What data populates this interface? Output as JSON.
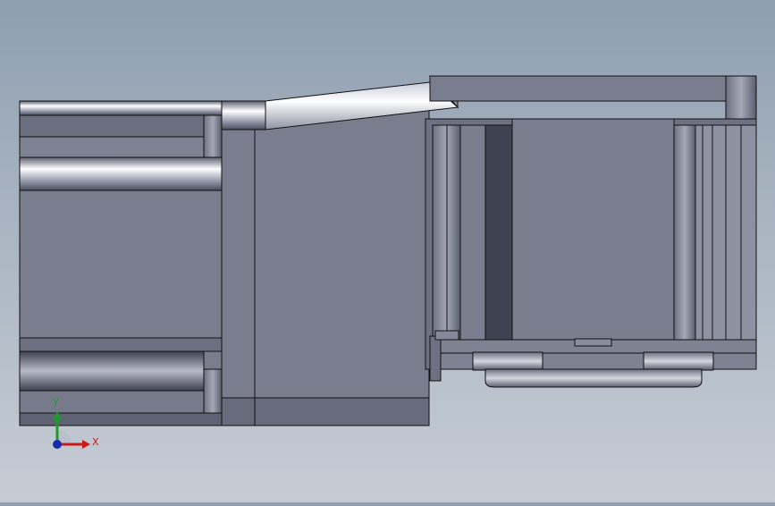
{
  "viewport": {
    "background_top": "#8f9fb0",
    "background_bottom": "#c6ccd4",
    "model_body_color": "#7a7d8e",
    "model_edge_color": "#111111"
  },
  "triad": {
    "x_label": "X",
    "y_label": "Y",
    "x_color": "#cc1a1a",
    "y_color": "#1f9a2a",
    "z_color": "#1a2ab0",
    "icons": [
      "axis-x-arrow",
      "axis-y-arrow",
      "axis-z-origin"
    ]
  }
}
